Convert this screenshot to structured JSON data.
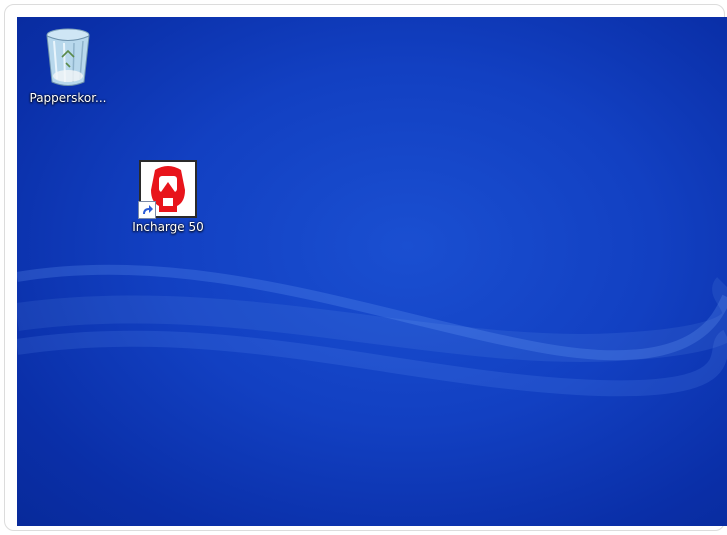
{
  "desktop": {
    "icons": [
      {
        "label": "Papperskor...",
        "icon": "recycle-bin-icon"
      },
      {
        "label": "Incharge 50",
        "icon": "incharge-app-icon"
      }
    ]
  },
  "colors": {
    "desktop_blue": "#1240c2",
    "app_red": "#e8141b"
  }
}
